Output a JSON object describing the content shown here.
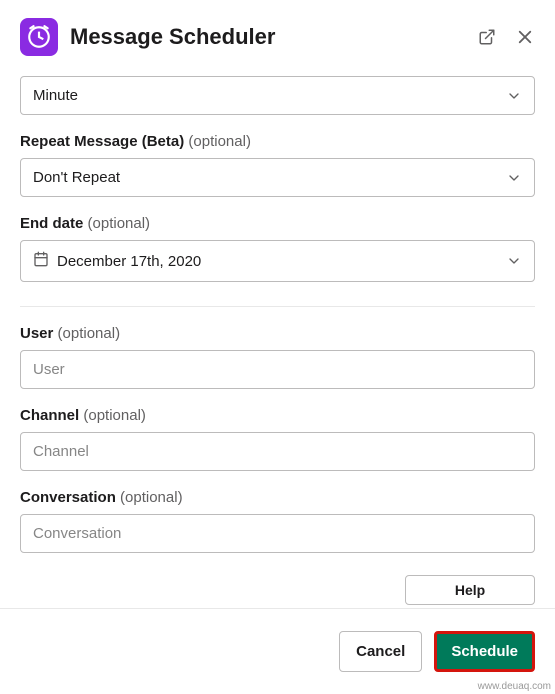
{
  "header": {
    "title": "Message Scheduler"
  },
  "fields": {
    "minute": {
      "value": "Minute"
    },
    "repeat": {
      "label": "Repeat Message (Beta)",
      "optional": "(optional)",
      "value": "Don't Repeat"
    },
    "end_date": {
      "label": "End date",
      "optional": "(optional)",
      "value": "December 17th, 2020"
    },
    "user": {
      "label": "User",
      "optional": "(optional)",
      "placeholder": "User"
    },
    "channel": {
      "label": "Channel",
      "optional": "(optional)",
      "placeholder": "Channel"
    },
    "conversation": {
      "label": "Conversation",
      "optional": "(optional)",
      "placeholder": "Conversation"
    }
  },
  "buttons": {
    "help": "Help",
    "cancel": "Cancel",
    "schedule": "Schedule"
  },
  "watermark": "www.deuaq.com"
}
